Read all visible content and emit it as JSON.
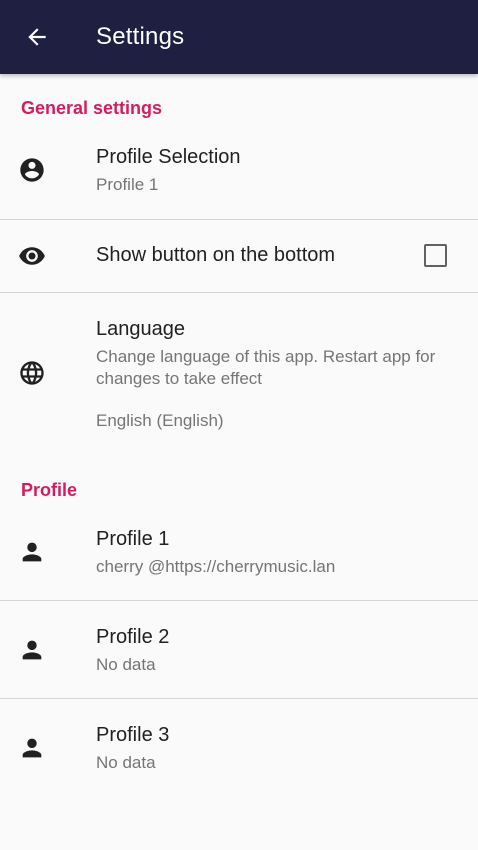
{
  "appbar": {
    "title": "Settings",
    "back_icon": "arrow-back-icon"
  },
  "sections": {
    "general": "General settings",
    "profile": "Profile"
  },
  "general": {
    "profile_selection": {
      "title": "Profile Selection",
      "summary": "Profile 1",
      "icon": "account-circle-icon"
    },
    "show_button": {
      "title": "Show button on the bottom",
      "checked": false,
      "icon": "eye-icon"
    },
    "language": {
      "title": "Language",
      "summary": "Change language of this app. Restart app for changes to take effect",
      "value": "English (English)",
      "icon": "globe-icon"
    }
  },
  "profiles": [
    {
      "title": "Profile 1",
      "summary": "cherry @https://cherrymusic.lan",
      "icon": "person-icon"
    },
    {
      "title": "Profile 2",
      "summary": "No data",
      "icon": "person-icon"
    },
    {
      "title": "Profile 3",
      "summary": "No data",
      "icon": "person-icon"
    }
  ],
  "colors": {
    "appbar": "#1f2041",
    "accent": "#d81b60",
    "background": "#fafafa"
  }
}
